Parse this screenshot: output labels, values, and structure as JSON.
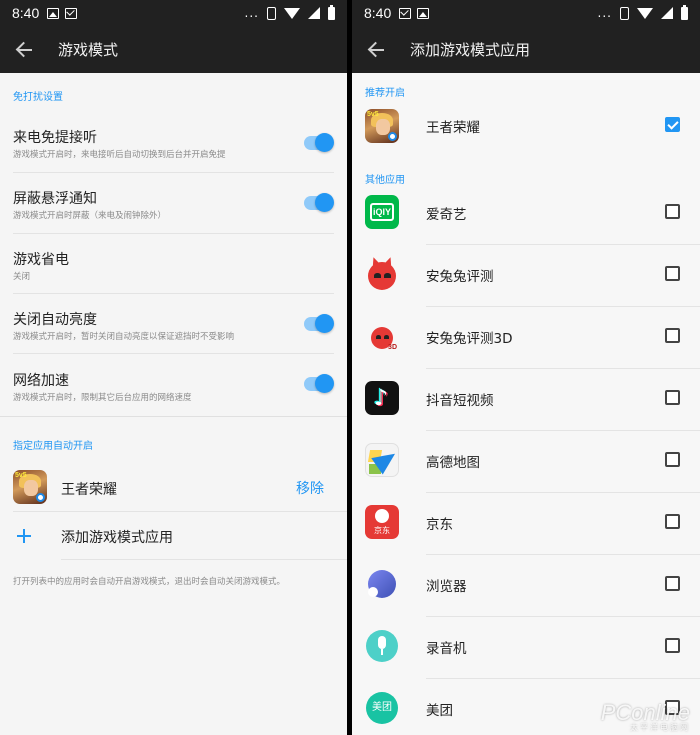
{
  "status": {
    "time": "8:40",
    "dots": "..."
  },
  "left": {
    "title": "游戏模式",
    "section_dnd": "免打扰设置",
    "settings": [
      {
        "title": "来电免提接听",
        "subtitle": "游戏模式开启时，来电接听后自动切换到后台并开启免提",
        "toggle": true
      },
      {
        "title": "屏蔽悬浮通知",
        "subtitle": "游戏模式开启时屏蔽（来电及闹钟除外）",
        "toggle": true
      },
      {
        "title": "游戏省电",
        "subtitle": "关闭",
        "toggle": false
      },
      {
        "title": "关闭自动亮度",
        "subtitle": "游戏模式开启时，暂时关闭自动亮度以保证遮挡时不受影响",
        "toggle": true
      },
      {
        "title": "网络加速",
        "subtitle": "游戏模式开启时，限制其它后台应用的网络速度",
        "toggle": true
      }
    ],
    "section_auto": "指定应用自动开启",
    "game_app": {
      "name": "王者荣耀",
      "remove": "移除",
      "badge": "5v5"
    },
    "add_label": "添加游戏模式应用",
    "footer": "打开列表中的应用时会自动开启游戏模式，退出时会自动关闭游戏模式。"
  },
  "right": {
    "title": "添加游戏模式应用",
    "section_recommended": "推荐开启",
    "recommended": [
      {
        "name": "王者荣耀",
        "checked": true
      }
    ],
    "section_other": "其他应用",
    "apps": [
      {
        "name": "爱奇艺",
        "icon": "iqiyi",
        "checked": false,
        "icon_text": "iQIY"
      },
      {
        "name": "安兔兔评测",
        "icon": "antutu",
        "checked": false
      },
      {
        "name": "安兔兔评测3D",
        "icon": "antutu3d",
        "checked": false,
        "icon_text": "3D"
      },
      {
        "name": "抖音短视频",
        "icon": "douyin",
        "checked": false,
        "icon_text": "♪"
      },
      {
        "name": "高德地图",
        "icon": "amap",
        "checked": false
      },
      {
        "name": "京东",
        "icon": "jd",
        "checked": false,
        "icon_text": "京东"
      },
      {
        "name": "浏览器",
        "icon": "browser",
        "checked": false
      },
      {
        "name": "录音机",
        "icon": "recorder",
        "checked": false
      },
      {
        "name": "美团",
        "icon": "meituan",
        "checked": false,
        "icon_text": "美团"
      }
    ]
  },
  "watermark": {
    "brand": "PConline",
    "sub": "太平洋电脑网"
  },
  "colors": {
    "accent": "#2196f3",
    "appbar": "#212121"
  }
}
